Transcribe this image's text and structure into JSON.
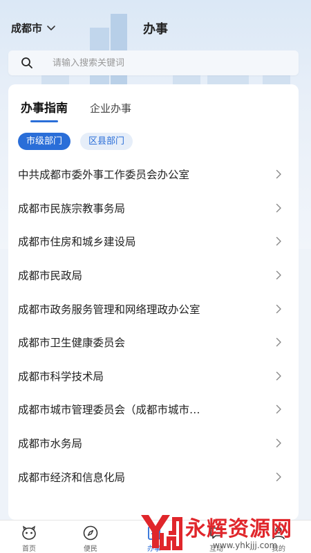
{
  "header": {
    "city": "成都市",
    "title": "办事"
  },
  "search": {
    "placeholder": "请输入搜索关键词"
  },
  "tabs": [
    {
      "label": "办事指南",
      "active": true
    },
    {
      "label": "企业办事",
      "active": false
    }
  ],
  "chips": [
    {
      "label": "市级部门",
      "active": true
    },
    {
      "label": "区县部门",
      "active": false
    }
  ],
  "departments": [
    "中共成都市委外事工作委员会办公室",
    "成都市民族宗教事务局",
    "成都市住房和城乡建设局",
    "成都市民政局",
    "成都市政务服务管理和网络理政办公室",
    "成都市卫生健康委员会",
    "成都市科学技术局",
    "成都市城市管理委员会（成都市城市…",
    "成都市水务局",
    "成都市经济和信息化局"
  ],
  "nav": [
    {
      "label": "首页",
      "icon": "home-icon"
    },
    {
      "label": "便民",
      "icon": "compass-icon"
    },
    {
      "label": "办事",
      "icon": "service-icon",
      "active": true
    },
    {
      "label": "互动",
      "icon": "chat-icon"
    },
    {
      "label": "我的",
      "icon": "user-icon"
    }
  ],
  "watermark": {
    "text": "永辉资源网",
    "url": "www.yhkjjj.com"
  },
  "colors": {
    "accent": "#2a6ed8",
    "watermark": "#e0262b"
  }
}
